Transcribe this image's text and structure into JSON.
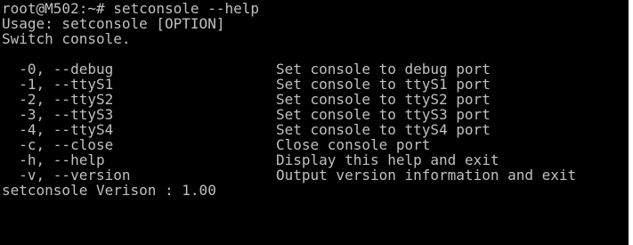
{
  "terminal": {
    "prompt_line": "root@M502:~# setconsole --help",
    "usage_line": "Usage: setconsole [OPTION]",
    "summary_line": "Switch console.",
    "options": [
      {
        "flag": "  -0, --debug",
        "description": "Set console to debug port"
      },
      {
        "flag": "  -1, --ttyS1",
        "description": "Set console to ttyS1 port"
      },
      {
        "flag": "  -2, --ttyS2",
        "description": "Set console to ttyS2 port"
      },
      {
        "flag": "  -3, --ttyS3",
        "description": "Set console to ttyS3 port"
      },
      {
        "flag": "  -4, --ttyS4",
        "description": "Set console to ttyS4 port"
      },
      {
        "flag": "  -c, --close",
        "description": "Close console port"
      },
      {
        "flag": "  -h, --help",
        "description": "Display this help and exit"
      },
      {
        "flag": "  -v, --version",
        "description": "Output version information and exit"
      }
    ],
    "version_line": "setconsole Verison : 1.00",
    "colors": {
      "background": "#000000",
      "foreground": "#c0c0c0"
    }
  }
}
